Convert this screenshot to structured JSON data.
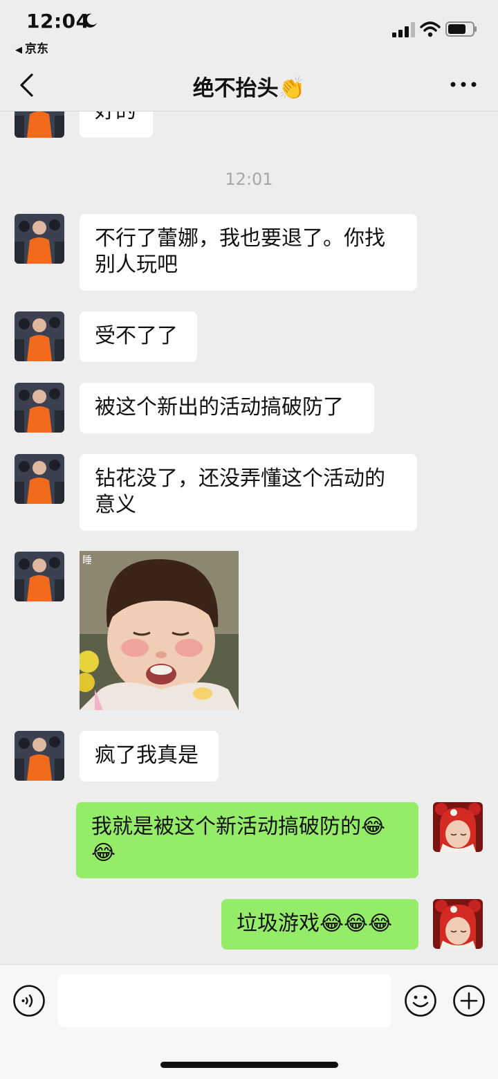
{
  "status_bar": {
    "time": "12:04",
    "back_app": "京东"
  },
  "nav": {
    "title": "绝不抬头👏"
  },
  "chat": {
    "timestamp": "12:01",
    "messages": [
      {
        "text": "好的"
      },
      {
        "text": "不行了蕾娜，我也要退了。你找别人玩吧"
      },
      {
        "text": "受不了了"
      },
      {
        "text": "被这个新出的活动搞破防了"
      },
      {
        "text": "钻花没了，还没弄懂这个活动的意义"
      },
      {
        "sticker_caption": "睡"
      },
      {
        "text": "疯了我真是"
      },
      {
        "text": "我就是被这个新活动搞破防的😂😂"
      },
      {
        "text": "垃圾游戏😂😂😂"
      }
    ]
  },
  "input": {
    "placeholder": ""
  },
  "colors": {
    "background": "#ededed",
    "my_bubble": "#95ec69",
    "other_bubble": "#ffffff",
    "avatar_jumpsuit": "#f26a1b"
  },
  "icons": {
    "nav_back": "chevron-left-icon",
    "nav_more": "more-dots-icon",
    "voice": "voice-icon",
    "emoji": "smile-icon",
    "more": "plus-icon"
  }
}
